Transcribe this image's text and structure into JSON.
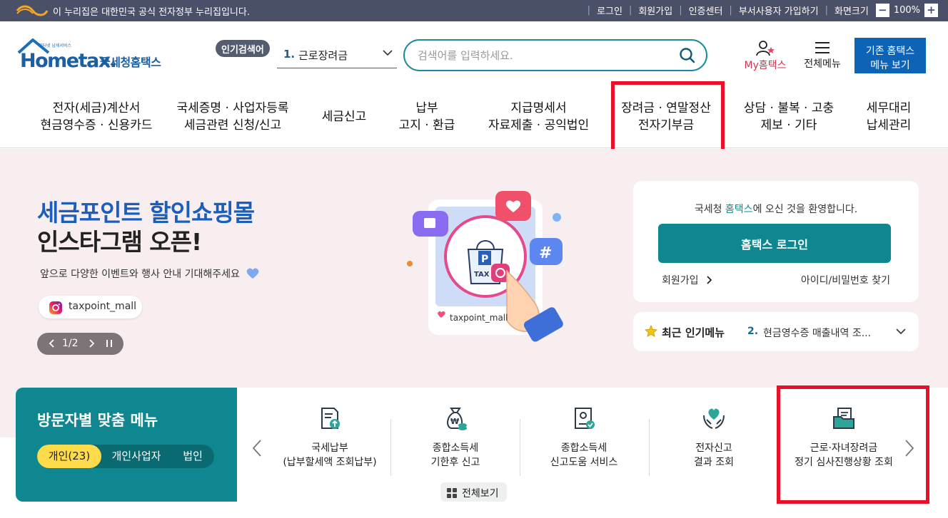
{
  "govbar": {
    "notice": "이 누리집은 대한민국 공식 전자정부 누리집입니다.",
    "links": [
      "로그인",
      "회원가입",
      "인증센터",
      "부서사용자 가입하기",
      "화면크기"
    ],
    "zoom": "100%",
    "zoom_minus": "−",
    "zoom_plus": "+"
  },
  "header": {
    "logo_text": "Hometax.",
    "logo_subtitle": "국세청홈택스",
    "hot_badge": "인기검색어",
    "hot_rank": "1.",
    "hot_keyword": "근로장려금",
    "search_placeholder": "검색어를 입력하세요.",
    "my_hometax": "My홈택스",
    "all_menu": "전체메뉴",
    "old_menu_line1": "기존 홈택스",
    "old_menu_line2": "메뉴 보기"
  },
  "gnb": [
    {
      "line1": "전자(세금)계산서",
      "line2": "현금영수증 · 신용카드"
    },
    {
      "line1": "국세증명 · 사업자등록",
      "line2": "세금관련 신청/신고"
    },
    {
      "line1": "세금신고",
      "line2": ""
    },
    {
      "line1": "납부",
      "line2": "고지 · 환급"
    },
    {
      "line1": "지급명세서",
      "line2": "자료제출 · 공익법인"
    },
    {
      "line1": "장려금 · 연말정산",
      "line2": "전자기부금"
    },
    {
      "line1": "상담 · 불복 · 고충",
      "line2": "제보 · 기타"
    },
    {
      "line1": "세무대리",
      "line2": "납세관리"
    }
  ],
  "hero": {
    "title1": "세금포인트 할인쇼핑몰",
    "title2": "인스타그램 오픈!",
    "desc": "앞으로 다양한 이벤트와 행사 안내 기대해주세요",
    "insta_handle": "taxpoint_mall",
    "pager": "1/2",
    "illust_handle": "taxpoint_mall"
  },
  "login": {
    "welcome_pre": "국세청 ",
    "welcome_hl": "홈택스",
    "welcome_post": "에 오신 것을 환영합니다.",
    "button": "홈택스 로그인",
    "join": "회원가입",
    "find": "아이디/비밀번호 찾기"
  },
  "popular": {
    "title": "최근 인기메뉴",
    "rank": "2.",
    "item": "현금영수증 매출내역 조..."
  },
  "visitor": {
    "title": "방문자별 맞춤 메뉴",
    "tabs": [
      "개인(23)",
      "개인사업자",
      "법인"
    ]
  },
  "services": [
    {
      "line1": "국세납부",
      "line2": "(납부할세액 조회납부)",
      "icon": "tax-payment-icon"
    },
    {
      "line1": "종합소득세",
      "line2": "기한후 신고",
      "icon": "money-bag-icon"
    },
    {
      "line1": "종합소득세",
      "line2": "신고도움 서비스",
      "icon": "certificate-icon"
    },
    {
      "line1": "전자신고",
      "line2": "결과 조회",
      "icon": "heart-hands-icon"
    },
    {
      "line1": "근로·자녀장려금",
      "line2": "정기 심사진행상황 조회",
      "icon": "folder-document-icon"
    }
  ],
  "view_all": "전체보기",
  "colors": {
    "govbar": "#4a5068",
    "teal": "#0e8790",
    "blue": "#0d63b5",
    "highlight_red": "#e9102a",
    "hero_bg": "#f8eeef",
    "tab_active": "#fedb4b"
  }
}
